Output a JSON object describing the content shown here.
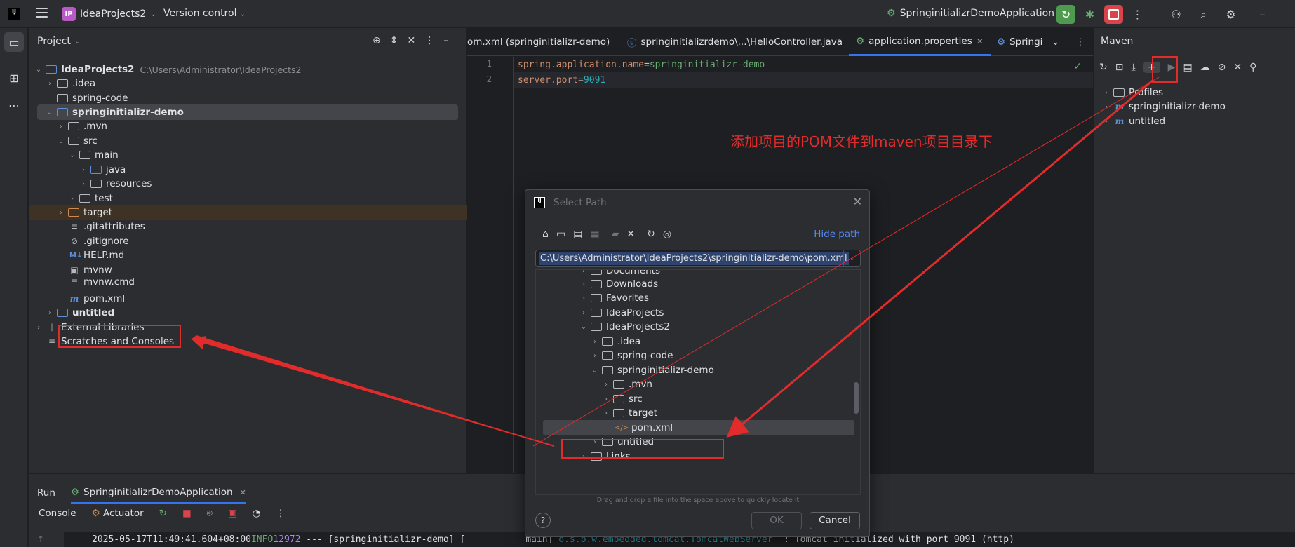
{
  "titlebar": {
    "logo": "IJ",
    "project_badge": "IP",
    "project_name": "IdeaProjects2",
    "vcs_label": "Version control",
    "run_config": "SpringinitializrDemoApplication"
  },
  "project_panel": {
    "title": "Project",
    "tree": [
      {
        "label": "IdeaProjects2",
        "hint": "C:\\Users\\Administrator\\IdeaProjects2"
      },
      {
        "label": ".idea"
      },
      {
        "label": "spring-code"
      },
      {
        "label": "springinitializr-demo"
      },
      {
        "label": ".mvn"
      },
      {
        "label": "src"
      },
      {
        "label": "main"
      },
      {
        "label": "java"
      },
      {
        "label": "resources"
      },
      {
        "label": "test"
      },
      {
        "label": "target"
      },
      {
        "label": ".gitattributes"
      },
      {
        "label": ".gitignore"
      },
      {
        "label": "HELP.md",
        "icon": "M↓"
      },
      {
        "label": "mvnw"
      },
      {
        "label": "mvnw.cmd"
      },
      {
        "label": "pom.xml",
        "icon": "m"
      },
      {
        "label": "untitled"
      },
      {
        "label": "External Libraries"
      },
      {
        "label": "Scratches and Consoles"
      }
    ]
  },
  "editor": {
    "tabs": [
      {
        "label": "om.xml (springinitializr-demo)"
      },
      {
        "label": "springinitializrdemo\\...\\HelloController.java"
      },
      {
        "label": "application.properties"
      },
      {
        "label": "Springin"
      }
    ],
    "lines": [
      {
        "num": "1",
        "key": "spring.application.name",
        "eq": "=",
        "value": "springinitializr-demo"
      },
      {
        "num": "2",
        "key": "server.port",
        "eq": "=",
        "value": "9091"
      }
    ]
  },
  "maven_panel": {
    "title": "Maven",
    "items": [
      {
        "label": "Profiles"
      },
      {
        "label": "springinitializr-demo",
        "icon": "m"
      },
      {
        "label": "untitled",
        "icon": "m"
      }
    ]
  },
  "annotation": {
    "text": "添加项目的POM文件到maven项目目录下",
    "color": "#e22b2b"
  },
  "dialog": {
    "title": "Select Path",
    "logo": "IJ",
    "hide_path": "Hide path",
    "path_value": "C:\\Users\\Administrator\\IdeaProjects2\\springinitializr-demo\\pom.xml",
    "tree": [
      {
        "label": "Documents"
      },
      {
        "label": "Downloads"
      },
      {
        "label": "Favorites"
      },
      {
        "label": "IdeaProjects"
      },
      {
        "label": "IdeaProjects2"
      },
      {
        "label": ".idea"
      },
      {
        "label": "spring-code"
      },
      {
        "label": "springinitializr-demo"
      },
      {
        "label": ".mvn"
      },
      {
        "label": "src"
      },
      {
        "label": "target"
      },
      {
        "label": "pom.xml",
        "icon": "</>"
      },
      {
        "label": "untitled"
      },
      {
        "label": "Links"
      }
    ],
    "hint": "Drag and drop a file into the space above to quickly locate it",
    "help": "?",
    "ok": "OK",
    "cancel": "Cancel"
  },
  "run_panel": {
    "title": "Run",
    "tab": "SpringinitializrDemoApplication",
    "console_tab": "Console",
    "actuator_tab": "Actuator",
    "log": {
      "timestamp": "2025-05-17T11:49:41.604+08:00",
      "level": "INFO",
      "pid": "12972",
      "mid": " --- [springinitializr-demo] [           main] ",
      "class": "o.s.b.w.embedded.tomcat.TomcatWebServer",
      "message": "  : Tomcat initialized with port 9091 (http)"
    }
  },
  "colors": {
    "accent": "#3574f0",
    "annotation_red": "#e22b2b",
    "run_green": "#4e9a4f",
    "stop_red": "#d9434a"
  }
}
